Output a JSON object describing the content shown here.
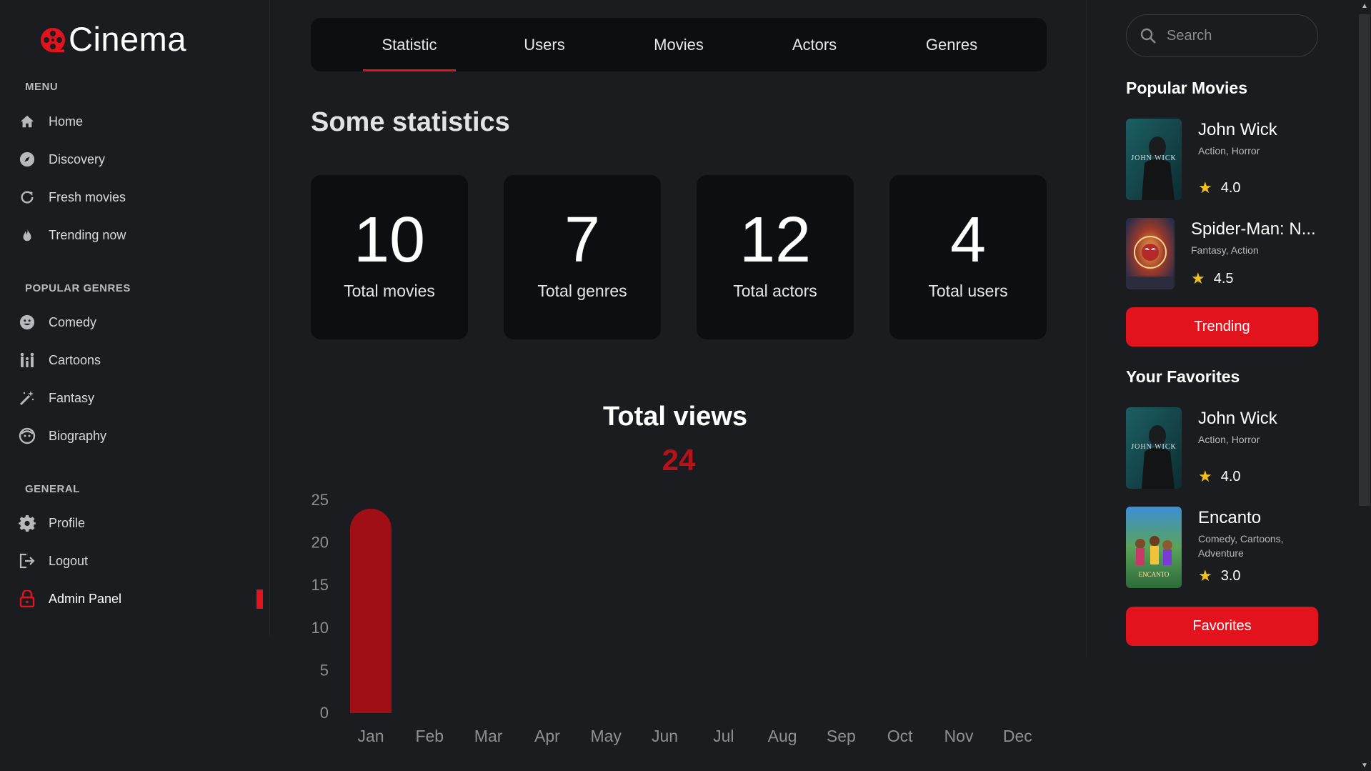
{
  "app": {
    "logo_text": "Cinema",
    "accent_color": "#e3131d"
  },
  "sidebar": {
    "sections": [
      {
        "title": "MENU",
        "items": [
          {
            "label": "Home",
            "icon": "home-icon"
          },
          {
            "label": "Discovery",
            "icon": "compass-icon"
          },
          {
            "label": "Fresh movies",
            "icon": "refresh-icon"
          },
          {
            "label": "Trending now",
            "icon": "fire-icon"
          }
        ]
      },
      {
        "title": "POPULAR GENRES",
        "items": [
          {
            "label": "Comedy",
            "icon": "smile-icon"
          },
          {
            "label": "Cartoons",
            "icon": "family-icon"
          },
          {
            "label": "Fantasy",
            "icon": "magic-wand-icon"
          },
          {
            "label": "Biography",
            "icon": "face-icon"
          }
        ]
      },
      {
        "title": "GENERAL",
        "items": [
          {
            "label": "Profile",
            "icon": "gear-icon"
          },
          {
            "label": "Logout",
            "icon": "logout-icon"
          },
          {
            "label": "Admin Panel",
            "icon": "lock-icon",
            "active": true
          }
        ]
      }
    ]
  },
  "tabs": [
    {
      "label": "Statistic",
      "active": true
    },
    {
      "label": "Users"
    },
    {
      "label": "Movies"
    },
    {
      "label": "Actors"
    },
    {
      "label": "Genres"
    }
  ],
  "main": {
    "title": "Some statistics",
    "stats": [
      {
        "value": "10",
        "label": "Total movies"
      },
      {
        "value": "7",
        "label": "Total genres"
      },
      {
        "value": "12",
        "label": "Total actors"
      },
      {
        "value": "4",
        "label": "Total users"
      }
    ]
  },
  "chart": {
    "title": "Total views",
    "total": "24"
  },
  "chart_data": {
    "type": "bar",
    "title": "Total views",
    "categories": [
      "Jan",
      "Feb",
      "Mar",
      "Apr",
      "May",
      "Jun",
      "Jul",
      "Aug",
      "Sep",
      "Oct",
      "Nov",
      "Dec"
    ],
    "values": [
      24,
      0,
      0,
      0,
      0,
      0,
      0,
      0,
      0,
      0,
      0,
      0
    ],
    "ylim": [
      0,
      25
    ],
    "yticks": [
      0,
      5,
      10,
      15,
      20,
      25
    ],
    "grid": false,
    "bar_color": "#a10f16"
  },
  "right": {
    "search_placeholder": "Search",
    "popular_heading": "Popular Movies",
    "popular": [
      {
        "title": "John Wick",
        "genres": "Action,  Horror",
        "rating": "4.0"
      },
      {
        "title": "Spider-Man: N...",
        "genres": "Fantasy,  Action",
        "rating": "4.5"
      }
    ],
    "trending_button": "Trending",
    "favorites_heading": "Your Favorites",
    "favorites": [
      {
        "title": "John Wick",
        "genres": "Action,  Horror",
        "rating": "4.0"
      },
      {
        "title": "Encanto",
        "genres": "Comedy,  Cartoons,  Adventure",
        "rating": "3.0"
      }
    ],
    "favorites_button": "Favorites",
    "poster_text": {
      "john_wick": "JOHN WICK",
      "encanto": "ENCANTO"
    }
  }
}
